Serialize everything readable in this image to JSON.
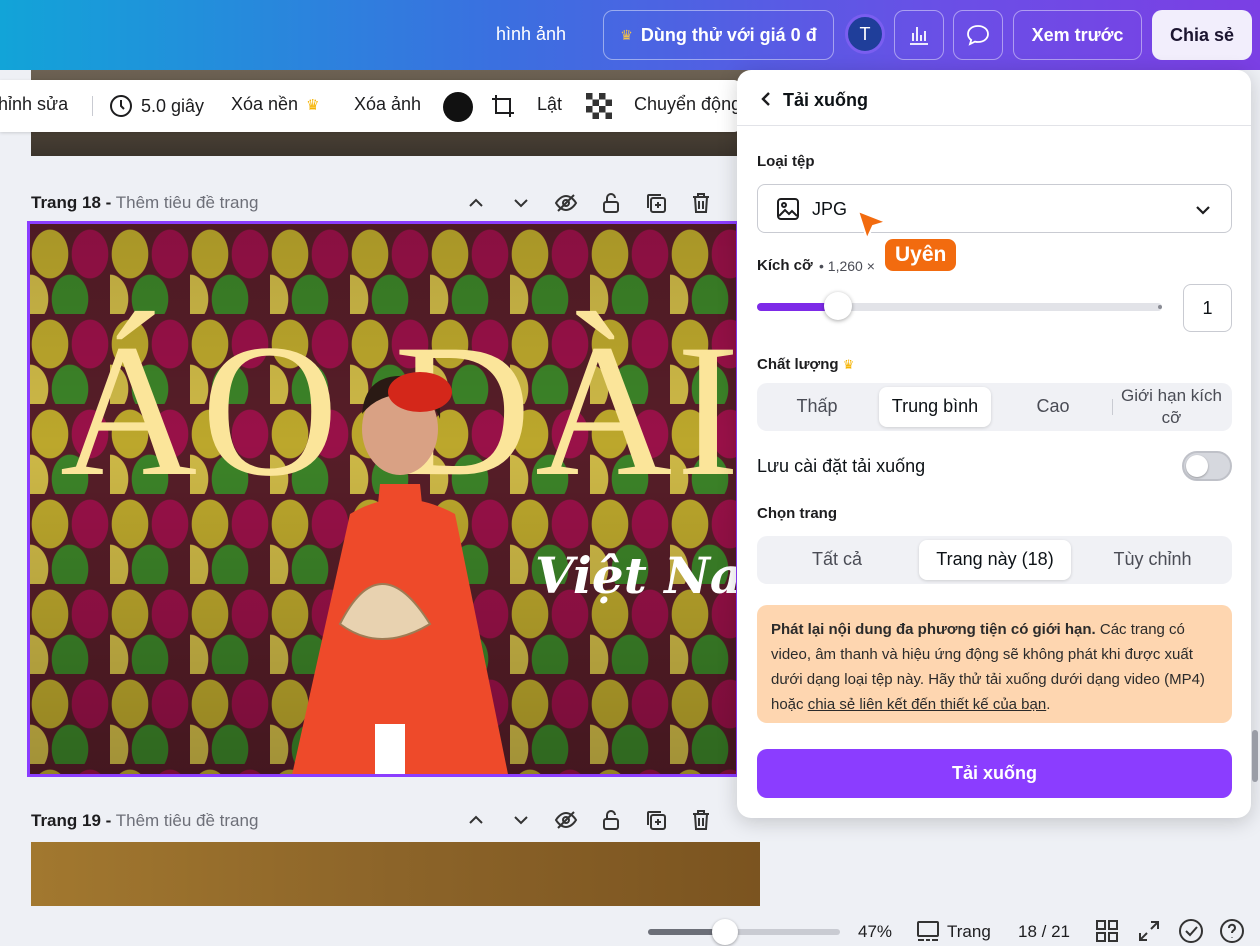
{
  "topbar": {
    "images_label": "hình ảnh",
    "trial_label": "Dùng thử với giá 0 đ",
    "avatar_letter": "T",
    "preview_label": "Xem trước",
    "share_label": "Chia sẻ"
  },
  "toolbar": {
    "edit_label": "hỉnh sửa",
    "duration_label": "5.0 giây",
    "remove_bg_label": "Xóa nền",
    "delete_image_label": "Xóa ảnh",
    "flip_label": "Lật",
    "animate_label": "Chuyển động"
  },
  "pages": {
    "p18_num": "Trang 18 -",
    "p18_title_placeholder": "Thêm tiêu đề trang",
    "p19_num": "Trang 19 -",
    "p19_title_placeholder": "Thêm tiêu đề trang"
  },
  "slide": {
    "title": "ÁO DÀI",
    "subtitle": "Việt Nam"
  },
  "download_panel": {
    "title": "Tải xuống",
    "file_type_label": "Loại tệp",
    "file_type_value": "JPG",
    "size_label": "Kích cỡ",
    "size_value": "• 1,260 ×",
    "size_multiplier": "1",
    "size_slider_fraction": 0.2,
    "quality_label": "Chất lượng",
    "quality_options": [
      "Thấp",
      "Trung bình",
      "Cao",
      "Giới hạn kích cỡ"
    ],
    "quality_selected": "Trung bình",
    "save_settings_label": "Lưu cài đặt tải xuống",
    "save_settings_on": false,
    "pages_label": "Chọn trang",
    "pages_options": [
      "Tất cả",
      "Trang này (18)",
      "Tùy chỉnh"
    ],
    "pages_selected": "Trang này (18)",
    "notice_bold": "Phát lại nội dung đa phương tiện có giới hạn.",
    "notice_text": " Các trang có video, âm thanh và hiệu ứng động sẽ không phát khi được xuất dưới dạng loại tệp này. Hãy thử tải xuống dưới dạng video (MP4) hoặc ",
    "notice_link": "chia sẻ liên kết đến thiết kế của bạn",
    "notice_end": ".",
    "download_button": "Tải xuống"
  },
  "collaborator": {
    "name": "Uyên",
    "color": "#f26b0f"
  },
  "bottombar": {
    "zoom_percent": "47%",
    "zoom_fraction": 0.4,
    "pages_label": "Trang",
    "page_counter": "18 / 21"
  },
  "colors": {
    "accent": "#8b3dff",
    "notice_bg": "#fed6b0"
  }
}
